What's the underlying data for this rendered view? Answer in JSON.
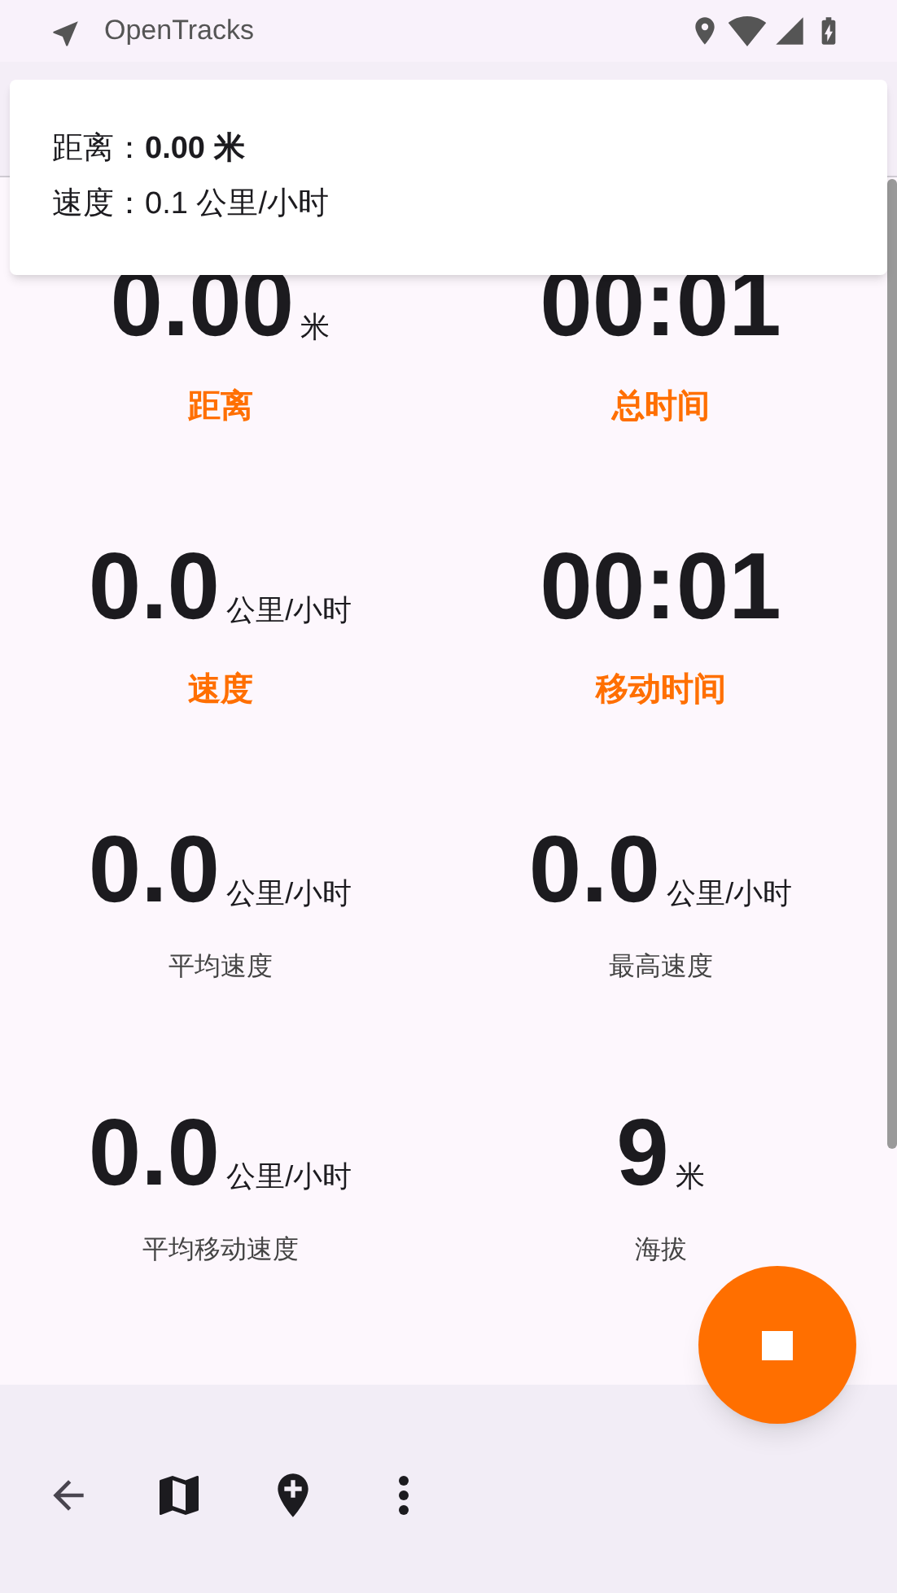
{
  "status_bar": {
    "app_name": "OpenTracks"
  },
  "popup": {
    "lines": [
      "距离：**0.00 米**",
      "速度：0.1 公里/小时"
    ]
  },
  "stats": [
    {
      "value": "0.00",
      "unit": "米",
      "label": "距离",
      "emphasized": true
    },
    {
      "value": "00:01",
      "label": "总时间",
      "emphasized": true
    },
    {
      "value": "0.0",
      "unit": "公里/小时",
      "label": "速度",
      "emphasized": true
    },
    {
      "value": "00:01",
      "label": "移动时间",
      "emphasized": true
    },
    {
      "value": "0.0",
      "unit": "公里/小时",
      "label": "平均速度",
      "emphasized": false
    },
    {
      "value": "0.0",
      "unit": "公里/小时",
      "label": "最高速度",
      "emphasized": false
    },
    {
      "value": "0.0",
      "unit": "公里/小时",
      "label": "平均移动速度",
      "emphasized": false
    },
    {
      "value": "9",
      "unit": "米",
      "label": "海拔",
      "emphasized": false
    }
  ]
}
